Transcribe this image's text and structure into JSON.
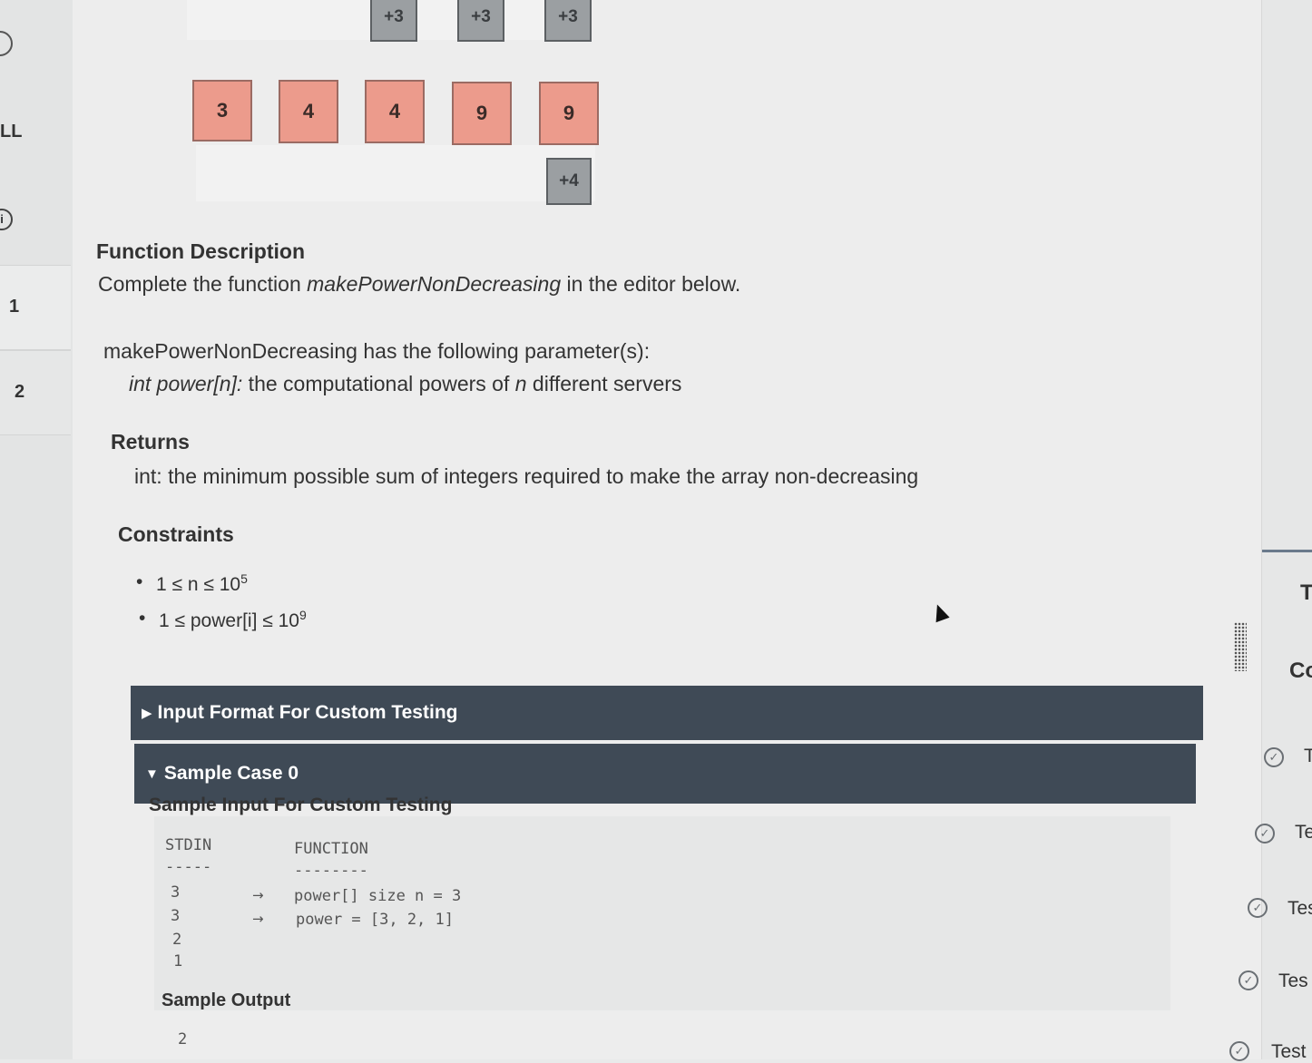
{
  "left_nav": {
    "label_partial": "LL",
    "question_numbers": [
      "1",
      "2"
    ]
  },
  "diagram": {
    "top_increments": [
      "+3",
      "+3",
      "+3"
    ],
    "values": [
      "3",
      "4",
      "4",
      "9",
      "9"
    ],
    "bottom_increments": [
      "+4"
    ]
  },
  "function_description": {
    "heading": "Function Description",
    "intro_prefix": "Complete the function ",
    "function_name": "makePowerNonDecreasing",
    "intro_suffix": " in the editor below.",
    "params_line": "makePowerNonDecreasing has the following parameter(s):",
    "param_name": "int power[n]:",
    "param_desc_prefix": " the computational powers of ",
    "param_desc_var": "n",
    "param_desc_suffix": " different servers"
  },
  "returns": {
    "heading": "Returns",
    "text": "int: the minimum possible sum of integers required to make the array non-decreasing"
  },
  "constraints": {
    "heading": "Constraints",
    "c1_base": "1 ≤ n ≤ 10",
    "c1_exp": "5",
    "c2_base": "1 ≤ power[i] ≤ 10",
    "c2_exp": "9"
  },
  "sections": {
    "input_format_label": "Input Format For Custom Testing",
    "sample_case_label": "Sample Case 0",
    "sample_input_heading": "Sample Input For Custom Testing",
    "sample_output_heading": "Sample Output"
  },
  "sample_input": {
    "col_stdin": "STDIN",
    "col_function": "FUNCTION",
    "stdin_rule": "-----",
    "function_rule": "--------",
    "stdin_values": [
      "3",
      "3",
      "2",
      "1"
    ],
    "arrow": "→",
    "function_lines": [
      "power[] size n = 3",
      "power = [3, 2, 1]"
    ]
  },
  "sample_output": {
    "value": "2"
  },
  "right_panel": {
    "partials": [
      "T",
      "Co",
      "T",
      "Te",
      "Tes",
      "Tes",
      "Test"
    ]
  }
}
